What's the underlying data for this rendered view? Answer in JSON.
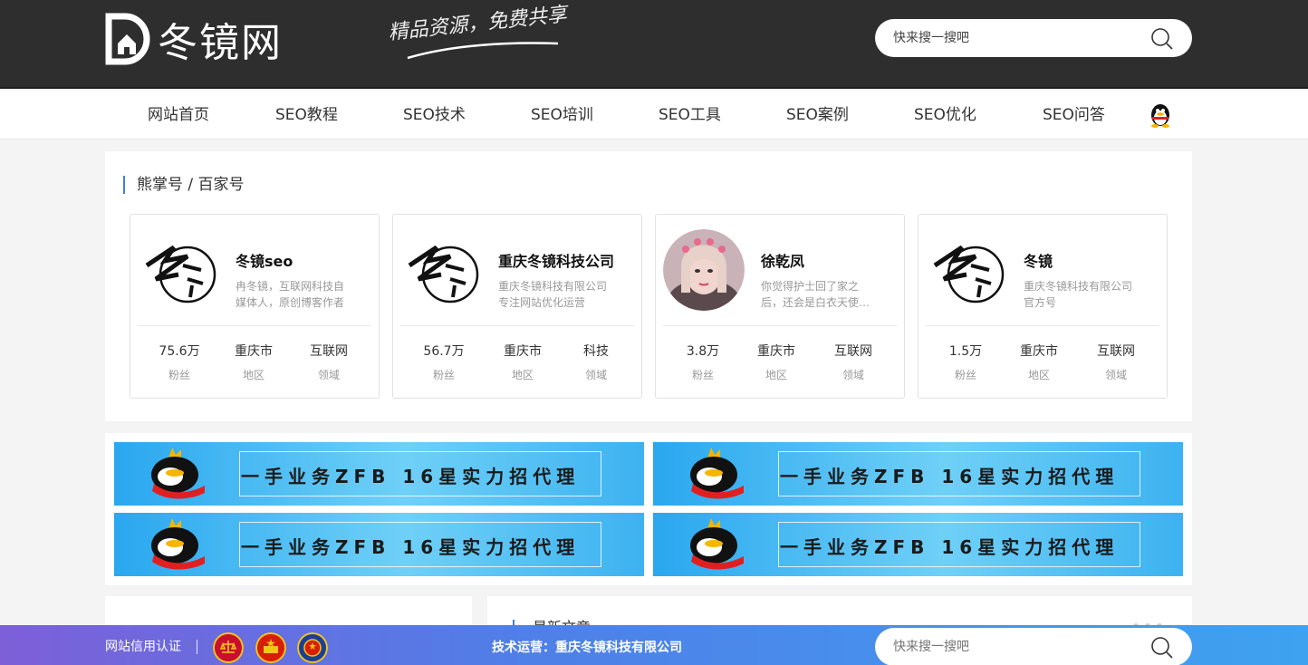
{
  "header": {
    "logo_text": "冬镜网",
    "slogan": "精品资源，免费共享",
    "search_placeholder": "快来搜一搜吧"
  },
  "nav": {
    "items": [
      {
        "label": "网站首页"
      },
      {
        "label": "SEO教程"
      },
      {
        "label": "SEO技术"
      },
      {
        "label": "SEO培训"
      },
      {
        "label": "SEO工具"
      },
      {
        "label": "SEO案例"
      },
      {
        "label": "SEO优化"
      },
      {
        "label": "SEO问答"
      }
    ]
  },
  "panel": {
    "title": "熊掌号 / 百家号",
    "cards": [
      {
        "name": "冬镜seo",
        "desc": "冉冬镜，互联网科技自媒体人，原创博客作者",
        "stats": [
          {
            "value": "75.6万",
            "label": "粉丝"
          },
          {
            "value": "重庆市",
            "label": "地区"
          },
          {
            "value": "互联网",
            "label": "领域"
          }
        ]
      },
      {
        "name": "重庆冬镜科技公司",
        "desc": "重庆冬镜科技有限公司专注网站优化运营",
        "stats": [
          {
            "value": "56.7万",
            "label": "粉丝"
          },
          {
            "value": "重庆市",
            "label": "地区"
          },
          {
            "value": "科技",
            "label": "领域"
          }
        ]
      },
      {
        "name": "徐乾凤",
        "desc": "你觉得护士回了家之后，还会是白衣天使…",
        "stats": [
          {
            "value": "3.8万",
            "label": "粉丝"
          },
          {
            "value": "重庆市",
            "label": "地区"
          },
          {
            "value": "互联网",
            "label": "领域"
          }
        ]
      },
      {
        "name": "冬镜",
        "desc": "重庆冬镜科技有限公司官方号",
        "stats": [
          {
            "value": "1.5万",
            "label": "粉丝"
          },
          {
            "value": "重庆市",
            "label": "地区"
          },
          {
            "value": "互联网",
            "label": "领域"
          }
        ]
      }
    ]
  },
  "ads": {
    "text": "一手业务ZFB 16星实力招代理"
  },
  "lower": {
    "latest_title": "最新文章"
  },
  "footer": {
    "cert_label": "网站信用认证",
    "ops_label": "技术运营：重庆冬镜科技有限公司",
    "search_placeholder": "快来搜一搜吧"
  },
  "colors": {
    "header_bg": "#2e2e2e",
    "accent": "#3f7ee8",
    "footer_gradient_start": "#7d5fd8",
    "footer_gradient_end": "#3ea2f0"
  }
}
